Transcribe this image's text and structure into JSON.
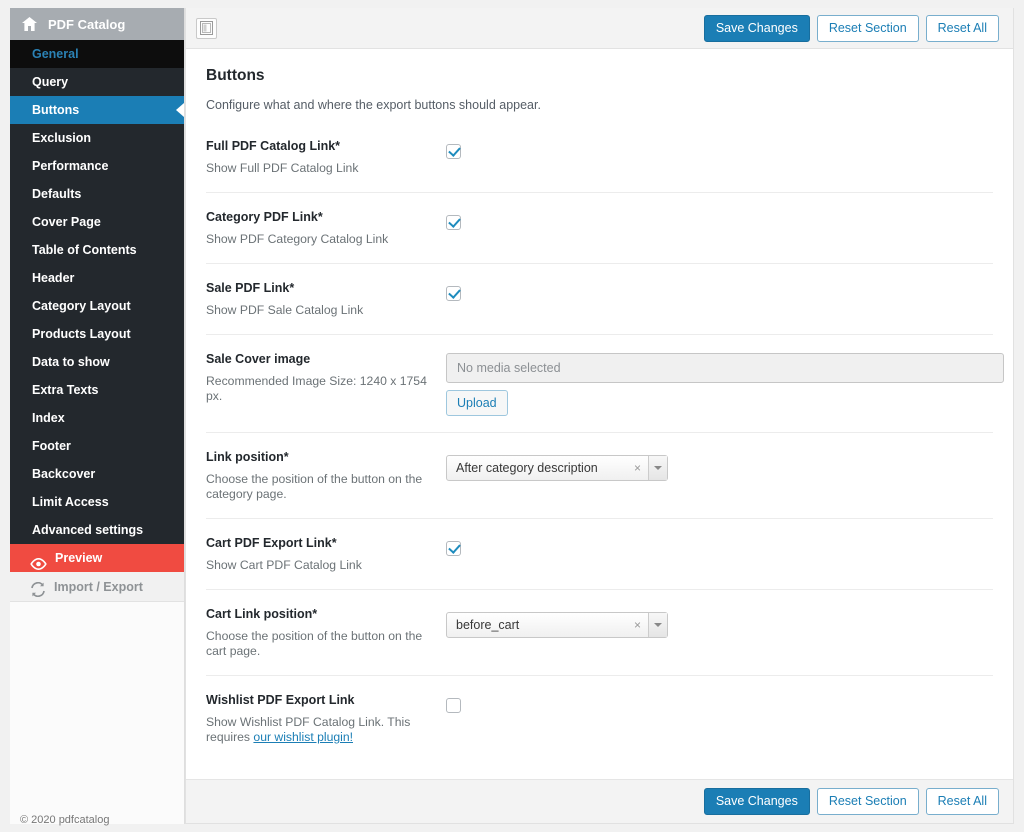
{
  "brand": {
    "title": "PDF Catalog",
    "icon": "home-icon"
  },
  "sidebar": {
    "items": [
      {
        "label": "General",
        "state": "visited"
      },
      {
        "label": "Query",
        "state": "normal"
      },
      {
        "label": "Buttons",
        "state": "active"
      },
      {
        "label": "Exclusion",
        "state": "normal"
      },
      {
        "label": "Performance",
        "state": "normal"
      },
      {
        "label": "Defaults",
        "state": "normal"
      },
      {
        "label": "Cover Page",
        "state": "normal"
      },
      {
        "label": "Table of Contents",
        "state": "normal"
      },
      {
        "label": "Header",
        "state": "normal"
      },
      {
        "label": "Category Layout",
        "state": "normal"
      },
      {
        "label": "Products Layout",
        "state": "normal"
      },
      {
        "label": "Data to show",
        "state": "normal"
      },
      {
        "label": "Extra Texts",
        "state": "normal"
      },
      {
        "label": "Index",
        "state": "normal"
      },
      {
        "label": "Footer",
        "state": "normal"
      },
      {
        "label": "Backcover",
        "state": "normal"
      },
      {
        "label": "Limit Access",
        "state": "normal"
      },
      {
        "label": "Advanced settings",
        "state": "normal"
      }
    ],
    "preview": {
      "label": "Preview",
      "icon": "eye-icon"
    },
    "import_export": {
      "label": "Import / Export",
      "icon": "sync-icon"
    }
  },
  "toolbar": {
    "layout_icon": "layout-toggle-icon",
    "save_label": "Save Changes",
    "reset_section_label": "Reset Section",
    "reset_all_label": "Reset All"
  },
  "main": {
    "title": "Buttons",
    "subtitle": "Configure what and where the export buttons should appear."
  },
  "rows": {
    "full_pdf": {
      "title": "Full PDF Catalog Link*",
      "desc": "Show Full PDF Catalog Link",
      "checked": true
    },
    "category_pdf": {
      "title": "Category PDF Link*",
      "desc": "Show PDF Category Catalog Link",
      "checked": true
    },
    "sale_pdf": {
      "title": "Sale PDF Link*",
      "desc": "Show PDF Sale Catalog Link",
      "checked": true
    },
    "sale_cover": {
      "title": "Sale Cover image",
      "desc": "Recommended Image Size: 1240 x 1754 px.",
      "media_placeholder": "No media selected",
      "upload_label": "Upload"
    },
    "link_position": {
      "title": "Link position*",
      "desc": "Choose the position of the button on the category page.",
      "value": "After category description",
      "clear_glyph": "×"
    },
    "cart_pdf": {
      "title": "Cart PDF Export Link*",
      "desc": "Show Cart PDF Catalog Link",
      "checked": true
    },
    "cart_link_position": {
      "title": "Cart Link position*",
      "desc": "Choose the position of the button on the cart page.",
      "value": "before_cart",
      "clear_glyph": "×"
    },
    "wishlist": {
      "title": "Wishlist PDF Export Link",
      "desc_before": "Show Wishlist PDF Catalog Link. This requires ",
      "desc_link": "our wishlist plugin!",
      "checked": false
    }
  },
  "footer": {
    "copyright": "© 2020 pdfcatalog"
  },
  "colors": {
    "accent_blue": "#1b7eb5",
    "sidebar_dark": "#23282d",
    "preview_red": "#f04b41",
    "brand_gray": "#a7acb1"
  }
}
